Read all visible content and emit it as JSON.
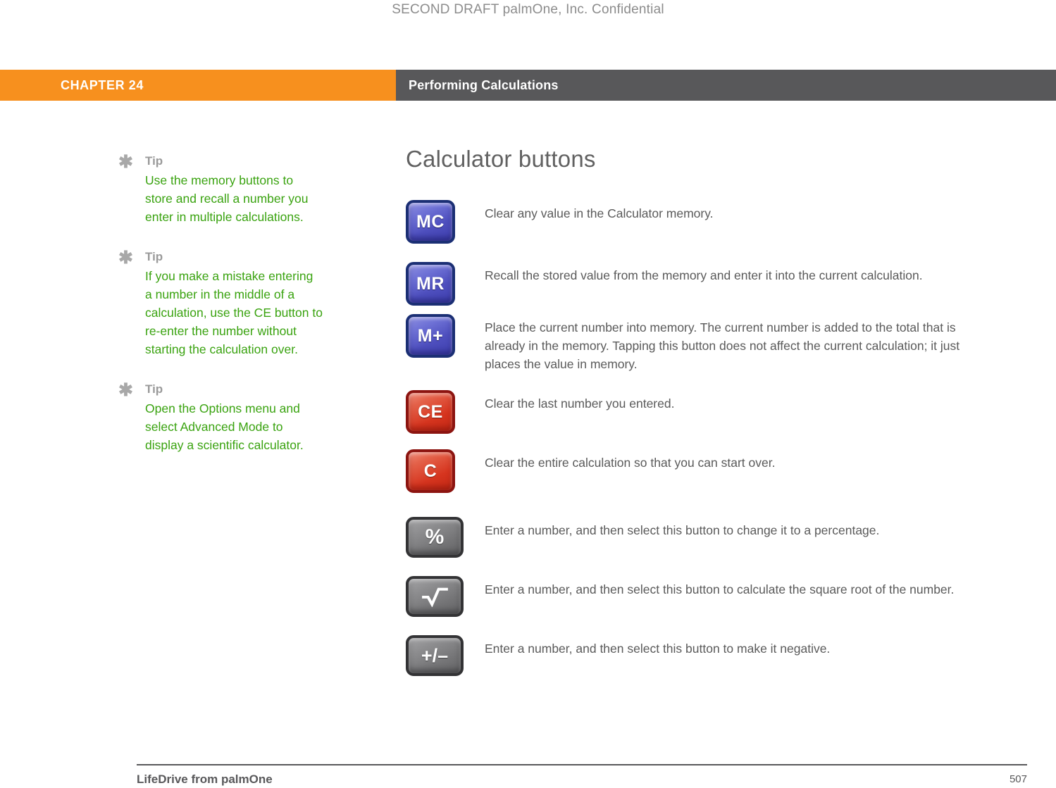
{
  "draft_header": "SECOND DRAFT palmOne, Inc.  Confidential",
  "banner": {
    "chapter_label": "CHAPTER 24",
    "chapter_title": "Performing Calculations",
    "orange": "#f7901e",
    "gray": "#58585a"
  },
  "tips": {
    "label": "Tip",
    "bullet": "*",
    "color": "#3aa310",
    "items": [
      {
        "label": "Tip",
        "text": "Use the memory buttons to store and recall a number you enter in multiple calculations."
      },
      {
        "label": "Tip",
        "text": "If you make a mistake entering a number in the middle of a calculation, use the CE button to re-enter the number without starting the calculation over."
      },
      {
        "label": "Tip",
        "text": "Open the Options menu and select Advanced Mode to display a scientific calculator."
      }
    ]
  },
  "main": {
    "title": "Calculator buttons",
    "buttons": [
      {
        "icon_name": "calculator-key-mc",
        "label": "MC",
        "style": "blue",
        "description": "Clear any value in the Calculator memory."
      },
      {
        "icon_name": "calculator-key-mr",
        "label": "MR",
        "style": "blue",
        "description": "Recall the stored value from the memory and enter it into the current calculation."
      },
      {
        "icon_name": "calculator-key-m-plus",
        "label": "M+",
        "style": "blue",
        "description": "Place the current number into memory. The current number is added to the total that is already in the memory. Tapping this button does not affect the current calculation; it just places the value in memory."
      },
      {
        "icon_name": "calculator-key-ce",
        "label": "CE",
        "style": "red",
        "description": "Clear the last number you entered."
      },
      {
        "icon_name": "calculator-key-c",
        "label": "C",
        "style": "red",
        "description": "Clear the entire calculation so that you can start over."
      },
      {
        "icon_name": "calculator-key-percent",
        "label": "%",
        "style": "gray",
        "description": "Enter a number, and then select this button to change it to a percentage."
      },
      {
        "icon_name": "calculator-key-square-root",
        "label": "√",
        "style": "gray",
        "description": "Enter a number, and then select this button to calculate the square root of the number."
      },
      {
        "icon_name": "calculator-key-plus-minus",
        "label": "+/–",
        "style": "gray",
        "description": "Enter a number, and then select this button to make it negative."
      }
    ]
  },
  "footer": {
    "product": "LifeDrive from palmOne",
    "page_number": "507"
  }
}
